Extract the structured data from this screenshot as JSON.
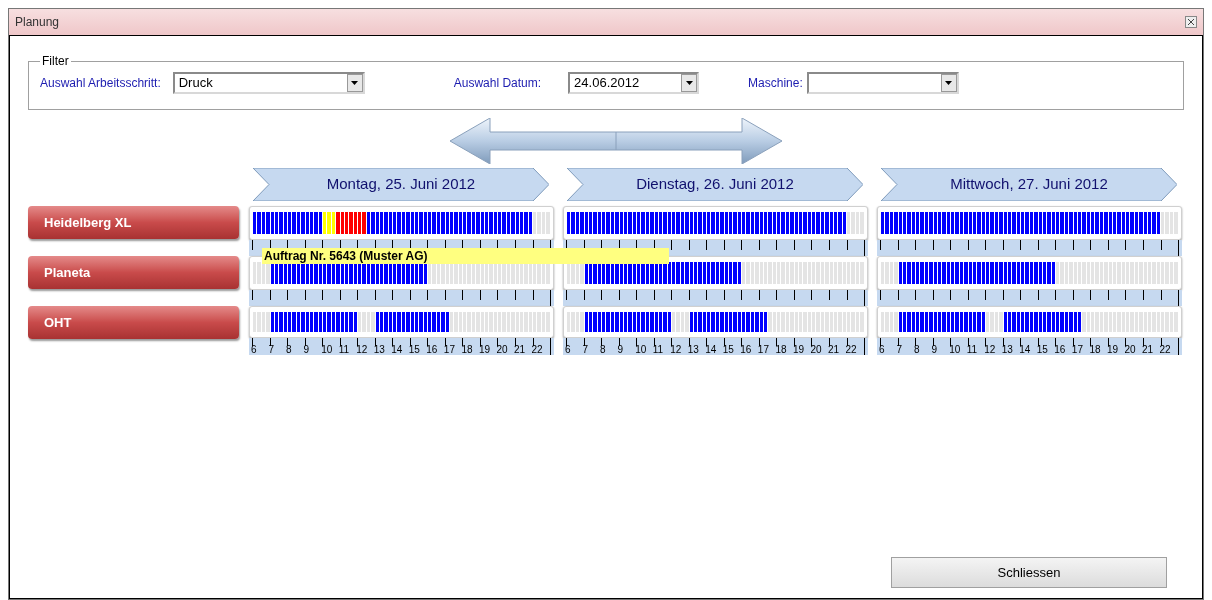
{
  "window": {
    "title": "Planung"
  },
  "filter": {
    "title": "Filter",
    "fields": [
      {
        "label": "Auswahl Arbeitsschritt:",
        "value": "Druck"
      },
      {
        "label": "Auswahl Datum:",
        "value": "24.06.2012"
      },
      {
        "label": "Maschine:"
      }
    ]
  },
  "machines": [
    "Heidelberg XL",
    "Planeta",
    "OHT"
  ],
  "days": [
    {
      "title": "Montag, 25. Juni 2012",
      "hours": [
        "6",
        "7",
        "8",
        "9",
        "10",
        "11",
        "12",
        "13",
        "14",
        "15",
        "16",
        "17",
        "18",
        "19",
        "20",
        "21",
        "22"
      ],
      "rows": [
        {
          "slots": [
            {
              "color": "#0000ff"
            },
            {
              "color": "#0000ff"
            },
            {
              "color": "#0000ff"
            },
            {
              "color": "#0000ff"
            },
            {
              "color": "#0000ff"
            },
            {
              "color": "#0000ff"
            },
            {
              "color": "#0000ff"
            },
            {
              "color": "#0000ff"
            },
            {
              "color": "#0000ff"
            },
            {
              "color": "#0000ff"
            },
            {
              "color": "#0000ff"
            },
            {
              "color": "#0000ff"
            },
            {
              "color": "#0000ff"
            },
            {
              "color": "#0000ff"
            },
            {
              "color": "#0000ff"
            },
            {
              "color": "#0000ff"
            },
            {
              "color": "#ffff00"
            },
            {
              "color": "#ffff00"
            },
            {
              "color": "#ffff00"
            },
            {
              "color": "#ff0000"
            },
            {
              "color": "#ff0000"
            },
            {
              "color": "#ff0000"
            },
            {
              "color": "#ff0000"
            },
            {
              "color": "#ff0000"
            },
            {
              "color": "#ff0000"
            },
            {
              "color": "#ff0000"
            },
            {
              "color": "#0000ff"
            },
            {
              "color": "#0000ff"
            },
            {
              "color": "#0000ff"
            },
            {
              "color": "#0000ff"
            },
            {
              "color": "#0000ff"
            },
            {
              "color": "#0000ff"
            },
            {
              "color": "#0000ff"
            },
            {
              "color": "#0000ff"
            },
            {
              "color": "#0000ff"
            },
            {
              "color": "#0000ff"
            },
            {
              "color": "#0000ff"
            },
            {
              "color": "#0000ff"
            },
            {
              "color": "#0000ff"
            },
            {
              "color": "#0000ff"
            },
            {
              "color": "#0000ff"
            },
            {
              "color": "#0000ff"
            },
            {
              "color": "#0000ff"
            },
            {
              "color": "#0000ff"
            },
            {
              "color": "#0000ff"
            },
            {
              "color": "#0000ff"
            },
            {
              "color": "#0000ff"
            },
            {
              "color": "#0000ff"
            },
            {
              "color": "#0000ff"
            },
            {
              "color": "#0000ff"
            },
            {
              "color": "#0000ff"
            },
            {
              "color": "#0000ff"
            },
            {
              "color": "#0000ff"
            },
            {
              "color": "#0000ff"
            },
            {
              "color": "#0000ff"
            },
            {
              "color": "#0000ff"
            },
            {
              "color": "#0000ff"
            },
            {
              "color": "#0000ff"
            },
            {
              "color": "#0000ff"
            },
            {
              "color": "#0000ff"
            },
            {
              "color": "#0000ff"
            },
            {
              "color": "#0000ff"
            },
            {
              "color": "#0000ff"
            },
            {
              "color": "#0000ff"
            },
            {
              "color": "#e4e4e4"
            },
            {
              "color": "#e4e4e4"
            },
            {
              "color": "#e4e4e4"
            },
            {
              "color": "#e4e4e4"
            }
          ]
        },
        {
          "slots": [
            {
              "color": "#e4e4e4"
            },
            {
              "color": "#e4e4e4"
            },
            {
              "color": "#e4e4e4"
            },
            {
              "color": "#e4e4e4"
            },
            {
              "color": "#0000ff"
            },
            {
              "color": "#0000ff"
            },
            {
              "color": "#0000ff"
            },
            {
              "color": "#0000ff"
            },
            {
              "color": "#0000ff"
            },
            {
              "color": "#0000ff"
            },
            {
              "color": "#0000ff"
            },
            {
              "color": "#0000ff"
            },
            {
              "color": "#0000ff"
            },
            {
              "color": "#0000ff"
            },
            {
              "color": "#0000ff"
            },
            {
              "color": "#0000ff"
            },
            {
              "color": "#0000ff"
            },
            {
              "color": "#0000ff"
            },
            {
              "color": "#0000ff"
            },
            {
              "color": "#0000ff"
            },
            {
              "color": "#0000ff"
            },
            {
              "color": "#0000ff"
            },
            {
              "color": "#0000ff"
            },
            {
              "color": "#0000ff"
            },
            {
              "color": "#0000ff"
            },
            {
              "color": "#0000ff"
            },
            {
              "color": "#0000ff"
            },
            {
              "color": "#0000ff"
            },
            {
              "color": "#0000ff"
            },
            {
              "color": "#0000ff"
            },
            {
              "color": "#0000ff"
            },
            {
              "color": "#0000ff"
            },
            {
              "color": "#0000ff"
            },
            {
              "color": "#0000ff"
            },
            {
              "color": "#0000ff"
            },
            {
              "color": "#0000ff"
            },
            {
              "color": "#0000ff"
            },
            {
              "color": "#0000ff"
            },
            {
              "color": "#0000ff"
            },
            {
              "color": "#0000ff"
            },
            {
              "color": "#e4e4e4"
            },
            {
              "color": "#e4e4e4"
            },
            {
              "color": "#e4e4e4"
            },
            {
              "color": "#e4e4e4"
            },
            {
              "color": "#e4e4e4"
            },
            {
              "color": "#e4e4e4"
            },
            {
              "color": "#e4e4e4"
            },
            {
              "color": "#e4e4e4"
            },
            {
              "color": "#e4e4e4"
            },
            {
              "color": "#e4e4e4"
            },
            {
              "color": "#e4e4e4"
            },
            {
              "color": "#e4e4e4"
            },
            {
              "color": "#e4e4e4"
            },
            {
              "color": "#e4e4e4"
            },
            {
              "color": "#e4e4e4"
            },
            {
              "color": "#e4e4e4"
            },
            {
              "color": "#e4e4e4"
            },
            {
              "color": "#e4e4e4"
            },
            {
              "color": "#e4e4e4"
            },
            {
              "color": "#e4e4e4"
            },
            {
              "color": "#e4e4e4"
            },
            {
              "color": "#e4e4e4"
            },
            {
              "color": "#e4e4e4"
            },
            {
              "color": "#e4e4e4"
            },
            {
              "color": "#e4e4e4"
            },
            {
              "color": "#e4e4e4"
            },
            {
              "color": "#e4e4e4"
            },
            {
              "color": "#e4e4e4"
            }
          ]
        },
        {
          "slots": [
            {
              "color": "#e4e4e4"
            },
            {
              "color": "#e4e4e4"
            },
            {
              "color": "#e4e4e4"
            },
            {
              "color": "#e4e4e4"
            },
            {
              "color": "#0000ff"
            },
            {
              "color": "#0000ff"
            },
            {
              "color": "#0000ff"
            },
            {
              "color": "#0000ff"
            },
            {
              "color": "#0000ff"
            },
            {
              "color": "#0000ff"
            },
            {
              "color": "#0000ff"
            },
            {
              "color": "#0000ff"
            },
            {
              "color": "#0000ff"
            },
            {
              "color": "#0000ff"
            },
            {
              "color": "#0000ff"
            },
            {
              "color": "#0000ff"
            },
            {
              "color": "#0000ff"
            },
            {
              "color": "#0000ff"
            },
            {
              "color": "#0000ff"
            },
            {
              "color": "#0000ff"
            },
            {
              "color": "#0000ff"
            },
            {
              "color": "#0000ff"
            },
            {
              "color": "#0000ff"
            },
            {
              "color": "#0000ff"
            },
            {
              "color": "#e4e4e4"
            },
            {
              "color": "#e4e4e4"
            },
            {
              "color": "#e4e4e4"
            },
            {
              "color": "#e4e4e4"
            },
            {
              "color": "#0000ff"
            },
            {
              "color": "#0000ff"
            },
            {
              "color": "#0000ff"
            },
            {
              "color": "#0000ff"
            },
            {
              "color": "#0000ff"
            },
            {
              "color": "#0000ff"
            },
            {
              "color": "#0000ff"
            },
            {
              "color": "#0000ff"
            },
            {
              "color": "#0000ff"
            },
            {
              "color": "#0000ff"
            },
            {
              "color": "#0000ff"
            },
            {
              "color": "#0000ff"
            },
            {
              "color": "#0000ff"
            },
            {
              "color": "#0000ff"
            },
            {
              "color": "#0000ff"
            },
            {
              "color": "#0000ff"
            },
            {
              "color": "#0000ff"
            },
            {
              "color": "#e4e4e4"
            },
            {
              "color": "#e4e4e4"
            },
            {
              "color": "#e4e4e4"
            },
            {
              "color": "#e4e4e4"
            },
            {
              "color": "#e4e4e4"
            },
            {
              "color": "#e4e4e4"
            },
            {
              "color": "#e4e4e4"
            },
            {
              "color": "#e4e4e4"
            },
            {
              "color": "#e4e4e4"
            },
            {
              "color": "#e4e4e4"
            },
            {
              "color": "#e4e4e4"
            },
            {
              "color": "#e4e4e4"
            },
            {
              "color": "#e4e4e4"
            },
            {
              "color": "#e4e4e4"
            },
            {
              "color": "#e4e4e4"
            },
            {
              "color": "#e4e4e4"
            },
            {
              "color": "#e4e4e4"
            },
            {
              "color": "#e4e4e4"
            },
            {
              "color": "#e4e4e4"
            },
            {
              "color": "#e4e4e4"
            },
            {
              "color": "#e4e4e4"
            },
            {
              "color": "#e4e4e4"
            },
            {
              "color": "#e4e4e4"
            }
          ]
        }
      ]
    },
    {
      "title": "Dienstag, 26. Juni 2012",
      "hours": [
        "6",
        "7",
        "8",
        "9",
        "10",
        "11",
        "12",
        "13",
        "14",
        "15",
        "16",
        "17",
        "18",
        "19",
        "20",
        "21",
        "22"
      ],
      "rows": [
        {
          "slots": [
            {
              "color": "#0000ff"
            },
            {
              "color": "#0000ff"
            },
            {
              "color": "#0000ff"
            },
            {
              "color": "#0000ff"
            },
            {
              "color": "#0000ff"
            },
            {
              "color": "#0000ff"
            },
            {
              "color": "#0000ff"
            },
            {
              "color": "#0000ff"
            },
            {
              "color": "#0000ff"
            },
            {
              "color": "#0000ff"
            },
            {
              "color": "#0000ff"
            },
            {
              "color": "#0000ff"
            },
            {
              "color": "#0000ff"
            },
            {
              "color": "#0000ff"
            },
            {
              "color": "#0000ff"
            },
            {
              "color": "#0000ff"
            },
            {
              "color": "#0000ff"
            },
            {
              "color": "#0000ff"
            },
            {
              "color": "#0000ff"
            },
            {
              "color": "#0000ff"
            },
            {
              "color": "#0000ff"
            },
            {
              "color": "#0000ff"
            },
            {
              "color": "#0000ff"
            },
            {
              "color": "#0000ff"
            },
            {
              "color": "#0000ff"
            },
            {
              "color": "#0000ff"
            },
            {
              "color": "#0000ff"
            },
            {
              "color": "#0000ff"
            },
            {
              "color": "#0000ff"
            },
            {
              "color": "#0000ff"
            },
            {
              "color": "#0000ff"
            },
            {
              "color": "#0000ff"
            },
            {
              "color": "#0000ff"
            },
            {
              "color": "#0000ff"
            },
            {
              "color": "#0000ff"
            },
            {
              "color": "#0000ff"
            },
            {
              "color": "#0000ff"
            },
            {
              "color": "#0000ff"
            },
            {
              "color": "#0000ff"
            },
            {
              "color": "#0000ff"
            },
            {
              "color": "#0000ff"
            },
            {
              "color": "#0000ff"
            },
            {
              "color": "#0000ff"
            },
            {
              "color": "#0000ff"
            },
            {
              "color": "#0000ff"
            },
            {
              "color": "#0000ff"
            },
            {
              "color": "#0000ff"
            },
            {
              "color": "#0000ff"
            },
            {
              "color": "#0000ff"
            },
            {
              "color": "#0000ff"
            },
            {
              "color": "#0000ff"
            },
            {
              "color": "#0000ff"
            },
            {
              "color": "#0000ff"
            },
            {
              "color": "#0000ff"
            },
            {
              "color": "#0000ff"
            },
            {
              "color": "#0000ff"
            },
            {
              "color": "#0000ff"
            },
            {
              "color": "#0000ff"
            },
            {
              "color": "#0000ff"
            },
            {
              "color": "#0000ff"
            },
            {
              "color": "#0000ff"
            },
            {
              "color": "#0000ff"
            },
            {
              "color": "#0000ff"
            },
            {
              "color": "#0000ff"
            },
            {
              "color": "#e4e4e4"
            },
            {
              "color": "#e4e4e4"
            },
            {
              "color": "#e4e4e4"
            },
            {
              "color": "#e4e4e4"
            }
          ]
        },
        {
          "slots": [
            {
              "color": "#e4e4e4"
            },
            {
              "color": "#e4e4e4"
            },
            {
              "color": "#e4e4e4"
            },
            {
              "color": "#e4e4e4"
            },
            {
              "color": "#0000ff"
            },
            {
              "color": "#0000ff"
            },
            {
              "color": "#0000ff"
            },
            {
              "color": "#0000ff"
            },
            {
              "color": "#0000ff"
            },
            {
              "color": "#0000ff"
            },
            {
              "color": "#0000ff"
            },
            {
              "color": "#0000ff"
            },
            {
              "color": "#0000ff"
            },
            {
              "color": "#0000ff"
            },
            {
              "color": "#0000ff"
            },
            {
              "color": "#0000ff"
            },
            {
              "color": "#0000ff"
            },
            {
              "color": "#0000ff"
            },
            {
              "color": "#0000ff"
            },
            {
              "color": "#0000ff"
            },
            {
              "color": "#0000ff"
            },
            {
              "color": "#0000ff"
            },
            {
              "color": "#0000ff"
            },
            {
              "color": "#0000ff"
            },
            {
              "color": "#0000ff"
            },
            {
              "color": "#0000ff"
            },
            {
              "color": "#0000ff"
            },
            {
              "color": "#0000ff"
            },
            {
              "color": "#0000ff"
            },
            {
              "color": "#0000ff"
            },
            {
              "color": "#0000ff"
            },
            {
              "color": "#0000ff"
            },
            {
              "color": "#0000ff"
            },
            {
              "color": "#0000ff"
            },
            {
              "color": "#0000ff"
            },
            {
              "color": "#0000ff"
            },
            {
              "color": "#0000ff"
            },
            {
              "color": "#0000ff"
            },
            {
              "color": "#0000ff"
            },
            {
              "color": "#0000ff"
            },
            {
              "color": "#e4e4e4"
            },
            {
              "color": "#e4e4e4"
            },
            {
              "color": "#e4e4e4"
            },
            {
              "color": "#e4e4e4"
            },
            {
              "color": "#e4e4e4"
            },
            {
              "color": "#e4e4e4"
            },
            {
              "color": "#e4e4e4"
            },
            {
              "color": "#e4e4e4"
            },
            {
              "color": "#e4e4e4"
            },
            {
              "color": "#e4e4e4"
            },
            {
              "color": "#e4e4e4"
            },
            {
              "color": "#e4e4e4"
            },
            {
              "color": "#e4e4e4"
            },
            {
              "color": "#e4e4e4"
            },
            {
              "color": "#e4e4e4"
            },
            {
              "color": "#e4e4e4"
            },
            {
              "color": "#e4e4e4"
            },
            {
              "color": "#e4e4e4"
            },
            {
              "color": "#e4e4e4"
            },
            {
              "color": "#e4e4e4"
            },
            {
              "color": "#e4e4e4"
            },
            {
              "color": "#e4e4e4"
            },
            {
              "color": "#e4e4e4"
            },
            {
              "color": "#e4e4e4"
            },
            {
              "color": "#e4e4e4"
            },
            {
              "color": "#e4e4e4"
            },
            {
              "color": "#e4e4e4"
            },
            {
              "color": "#e4e4e4"
            }
          ]
        },
        {
          "slots": [
            {
              "color": "#e4e4e4"
            },
            {
              "color": "#e4e4e4"
            },
            {
              "color": "#e4e4e4"
            },
            {
              "color": "#e4e4e4"
            },
            {
              "color": "#0000ff"
            },
            {
              "color": "#0000ff"
            },
            {
              "color": "#0000ff"
            },
            {
              "color": "#0000ff"
            },
            {
              "color": "#0000ff"
            },
            {
              "color": "#0000ff"
            },
            {
              "color": "#0000ff"
            },
            {
              "color": "#0000ff"
            },
            {
              "color": "#0000ff"
            },
            {
              "color": "#0000ff"
            },
            {
              "color": "#0000ff"
            },
            {
              "color": "#0000ff"
            },
            {
              "color": "#0000ff"
            },
            {
              "color": "#0000ff"
            },
            {
              "color": "#0000ff"
            },
            {
              "color": "#0000ff"
            },
            {
              "color": "#0000ff"
            },
            {
              "color": "#0000ff"
            },
            {
              "color": "#0000ff"
            },
            {
              "color": "#0000ff"
            },
            {
              "color": "#e4e4e4"
            },
            {
              "color": "#e4e4e4"
            },
            {
              "color": "#e4e4e4"
            },
            {
              "color": "#e4e4e4"
            },
            {
              "color": "#0000ff"
            },
            {
              "color": "#0000ff"
            },
            {
              "color": "#0000ff"
            },
            {
              "color": "#0000ff"
            },
            {
              "color": "#0000ff"
            },
            {
              "color": "#0000ff"
            },
            {
              "color": "#0000ff"
            },
            {
              "color": "#0000ff"
            },
            {
              "color": "#0000ff"
            },
            {
              "color": "#0000ff"
            },
            {
              "color": "#0000ff"
            },
            {
              "color": "#0000ff"
            },
            {
              "color": "#0000ff"
            },
            {
              "color": "#0000ff"
            },
            {
              "color": "#0000ff"
            },
            {
              "color": "#0000ff"
            },
            {
              "color": "#0000ff"
            },
            {
              "color": "#0000ff"
            },
            {
              "color": "#e4e4e4"
            },
            {
              "color": "#e4e4e4"
            },
            {
              "color": "#e4e4e4"
            },
            {
              "color": "#e4e4e4"
            },
            {
              "color": "#e4e4e4"
            },
            {
              "color": "#e4e4e4"
            },
            {
              "color": "#e4e4e4"
            },
            {
              "color": "#e4e4e4"
            },
            {
              "color": "#e4e4e4"
            },
            {
              "color": "#e4e4e4"
            },
            {
              "color": "#e4e4e4"
            },
            {
              "color": "#e4e4e4"
            },
            {
              "color": "#e4e4e4"
            },
            {
              "color": "#e4e4e4"
            },
            {
              "color": "#e4e4e4"
            },
            {
              "color": "#e4e4e4"
            },
            {
              "color": "#e4e4e4"
            },
            {
              "color": "#e4e4e4"
            },
            {
              "color": "#e4e4e4"
            },
            {
              "color": "#e4e4e4"
            },
            {
              "color": "#e4e4e4"
            },
            {
              "color": "#e4e4e4"
            }
          ]
        }
      ]
    },
    {
      "title": "Mittwoch, 27. Juni 2012",
      "hours": [
        "6",
        "7",
        "8",
        "9",
        "10",
        "11",
        "12",
        "13",
        "14",
        "15",
        "16",
        "17",
        "18",
        "19",
        "20",
        "21",
        "22"
      ],
      "rows": [
        {
          "slots": [
            {
              "color": "#0000ff"
            },
            {
              "color": "#0000ff"
            },
            {
              "color": "#0000ff"
            },
            {
              "color": "#0000ff"
            },
            {
              "color": "#0000ff"
            },
            {
              "color": "#0000ff"
            },
            {
              "color": "#0000ff"
            },
            {
              "color": "#0000ff"
            },
            {
              "color": "#0000ff"
            },
            {
              "color": "#0000ff"
            },
            {
              "color": "#0000ff"
            },
            {
              "color": "#0000ff"
            },
            {
              "color": "#0000ff"
            },
            {
              "color": "#0000ff"
            },
            {
              "color": "#0000ff"
            },
            {
              "color": "#0000ff"
            },
            {
              "color": "#0000ff"
            },
            {
              "color": "#0000ff"
            },
            {
              "color": "#0000ff"
            },
            {
              "color": "#0000ff"
            },
            {
              "color": "#0000ff"
            },
            {
              "color": "#0000ff"
            },
            {
              "color": "#0000ff"
            },
            {
              "color": "#0000ff"
            },
            {
              "color": "#0000ff"
            },
            {
              "color": "#0000ff"
            },
            {
              "color": "#0000ff"
            },
            {
              "color": "#0000ff"
            },
            {
              "color": "#0000ff"
            },
            {
              "color": "#0000ff"
            },
            {
              "color": "#0000ff"
            },
            {
              "color": "#0000ff"
            },
            {
              "color": "#0000ff"
            },
            {
              "color": "#0000ff"
            },
            {
              "color": "#0000ff"
            },
            {
              "color": "#0000ff"
            },
            {
              "color": "#0000ff"
            },
            {
              "color": "#0000ff"
            },
            {
              "color": "#0000ff"
            },
            {
              "color": "#0000ff"
            },
            {
              "color": "#0000ff"
            },
            {
              "color": "#0000ff"
            },
            {
              "color": "#0000ff"
            },
            {
              "color": "#0000ff"
            },
            {
              "color": "#0000ff"
            },
            {
              "color": "#0000ff"
            },
            {
              "color": "#0000ff"
            },
            {
              "color": "#0000ff"
            },
            {
              "color": "#0000ff"
            },
            {
              "color": "#0000ff"
            },
            {
              "color": "#0000ff"
            },
            {
              "color": "#0000ff"
            },
            {
              "color": "#0000ff"
            },
            {
              "color": "#0000ff"
            },
            {
              "color": "#0000ff"
            },
            {
              "color": "#0000ff"
            },
            {
              "color": "#0000ff"
            },
            {
              "color": "#0000ff"
            },
            {
              "color": "#0000ff"
            },
            {
              "color": "#0000ff"
            },
            {
              "color": "#0000ff"
            },
            {
              "color": "#0000ff"
            },
            {
              "color": "#0000ff"
            },
            {
              "color": "#0000ff"
            },
            {
              "color": "#e4e4e4"
            },
            {
              "color": "#e4e4e4"
            },
            {
              "color": "#e4e4e4"
            },
            {
              "color": "#e4e4e4"
            }
          ]
        },
        {
          "slots": [
            {
              "color": "#e4e4e4"
            },
            {
              "color": "#e4e4e4"
            },
            {
              "color": "#e4e4e4"
            },
            {
              "color": "#e4e4e4"
            },
            {
              "color": "#0000ff"
            },
            {
              "color": "#0000ff"
            },
            {
              "color": "#0000ff"
            },
            {
              "color": "#0000ff"
            },
            {
              "color": "#0000ff"
            },
            {
              "color": "#0000ff"
            },
            {
              "color": "#0000ff"
            },
            {
              "color": "#0000ff"
            },
            {
              "color": "#0000ff"
            },
            {
              "color": "#0000ff"
            },
            {
              "color": "#0000ff"
            },
            {
              "color": "#0000ff"
            },
            {
              "color": "#0000ff"
            },
            {
              "color": "#0000ff"
            },
            {
              "color": "#0000ff"
            },
            {
              "color": "#0000ff"
            },
            {
              "color": "#0000ff"
            },
            {
              "color": "#0000ff"
            },
            {
              "color": "#0000ff"
            },
            {
              "color": "#0000ff"
            },
            {
              "color": "#0000ff"
            },
            {
              "color": "#0000ff"
            },
            {
              "color": "#0000ff"
            },
            {
              "color": "#0000ff"
            },
            {
              "color": "#0000ff"
            },
            {
              "color": "#0000ff"
            },
            {
              "color": "#0000ff"
            },
            {
              "color": "#0000ff"
            },
            {
              "color": "#0000ff"
            },
            {
              "color": "#0000ff"
            },
            {
              "color": "#0000ff"
            },
            {
              "color": "#0000ff"
            },
            {
              "color": "#0000ff"
            },
            {
              "color": "#0000ff"
            },
            {
              "color": "#0000ff"
            },
            {
              "color": "#0000ff"
            },
            {
              "color": "#e4e4e4"
            },
            {
              "color": "#e4e4e4"
            },
            {
              "color": "#e4e4e4"
            },
            {
              "color": "#e4e4e4"
            },
            {
              "color": "#e4e4e4"
            },
            {
              "color": "#e4e4e4"
            },
            {
              "color": "#e4e4e4"
            },
            {
              "color": "#e4e4e4"
            },
            {
              "color": "#e4e4e4"
            },
            {
              "color": "#e4e4e4"
            },
            {
              "color": "#e4e4e4"
            },
            {
              "color": "#e4e4e4"
            },
            {
              "color": "#e4e4e4"
            },
            {
              "color": "#e4e4e4"
            },
            {
              "color": "#e4e4e4"
            },
            {
              "color": "#e4e4e4"
            },
            {
              "color": "#e4e4e4"
            },
            {
              "color": "#e4e4e4"
            },
            {
              "color": "#e4e4e4"
            },
            {
              "color": "#e4e4e4"
            },
            {
              "color": "#e4e4e4"
            },
            {
              "color": "#e4e4e4"
            },
            {
              "color": "#e4e4e4"
            },
            {
              "color": "#e4e4e4"
            },
            {
              "color": "#e4e4e4"
            },
            {
              "color": "#e4e4e4"
            },
            {
              "color": "#e4e4e4"
            },
            {
              "color": "#e4e4e4"
            }
          ]
        },
        {
          "slots": [
            {
              "color": "#e4e4e4"
            },
            {
              "color": "#e4e4e4"
            },
            {
              "color": "#e4e4e4"
            },
            {
              "color": "#e4e4e4"
            },
            {
              "color": "#0000ff"
            },
            {
              "color": "#0000ff"
            },
            {
              "color": "#0000ff"
            },
            {
              "color": "#0000ff"
            },
            {
              "color": "#0000ff"
            },
            {
              "color": "#0000ff"
            },
            {
              "color": "#0000ff"
            },
            {
              "color": "#0000ff"
            },
            {
              "color": "#0000ff"
            },
            {
              "color": "#0000ff"
            },
            {
              "color": "#0000ff"
            },
            {
              "color": "#0000ff"
            },
            {
              "color": "#0000ff"
            },
            {
              "color": "#0000ff"
            },
            {
              "color": "#0000ff"
            },
            {
              "color": "#0000ff"
            },
            {
              "color": "#0000ff"
            },
            {
              "color": "#0000ff"
            },
            {
              "color": "#0000ff"
            },
            {
              "color": "#0000ff"
            },
            {
              "color": "#e4e4e4"
            },
            {
              "color": "#e4e4e4"
            },
            {
              "color": "#e4e4e4"
            },
            {
              "color": "#e4e4e4"
            },
            {
              "color": "#0000ff"
            },
            {
              "color": "#0000ff"
            },
            {
              "color": "#0000ff"
            },
            {
              "color": "#0000ff"
            },
            {
              "color": "#0000ff"
            },
            {
              "color": "#0000ff"
            },
            {
              "color": "#0000ff"
            },
            {
              "color": "#0000ff"
            },
            {
              "color": "#0000ff"
            },
            {
              "color": "#0000ff"
            },
            {
              "color": "#0000ff"
            },
            {
              "color": "#0000ff"
            },
            {
              "color": "#0000ff"
            },
            {
              "color": "#0000ff"
            },
            {
              "color": "#0000ff"
            },
            {
              "color": "#0000ff"
            },
            {
              "color": "#0000ff"
            },
            {
              "color": "#0000ff"
            },
            {
              "color": "#e4e4e4"
            },
            {
              "color": "#e4e4e4"
            },
            {
              "color": "#e4e4e4"
            },
            {
              "color": "#e4e4e4"
            },
            {
              "color": "#e4e4e4"
            },
            {
              "color": "#e4e4e4"
            },
            {
              "color": "#e4e4e4"
            },
            {
              "color": "#e4e4e4"
            },
            {
              "color": "#e4e4e4"
            },
            {
              "color": "#e4e4e4"
            },
            {
              "color": "#e4e4e4"
            },
            {
              "color": "#e4e4e4"
            },
            {
              "color": "#e4e4e4"
            },
            {
              "color": "#e4e4e4"
            },
            {
              "color": "#e4e4e4"
            },
            {
              "color": "#e4e4e4"
            },
            {
              "color": "#e4e4e4"
            },
            {
              "color": "#e4e4e4"
            },
            {
              "color": "#e4e4e4"
            },
            {
              "color": "#e4e4e4"
            },
            {
              "color": "#e4e4e4"
            },
            {
              "color": "#e4e4e4"
            }
          ]
        }
      ]
    }
  ],
  "tooltip": "Auftrag Nr. 5643 (Muster AG)",
  "close_button": "Schliessen"
}
